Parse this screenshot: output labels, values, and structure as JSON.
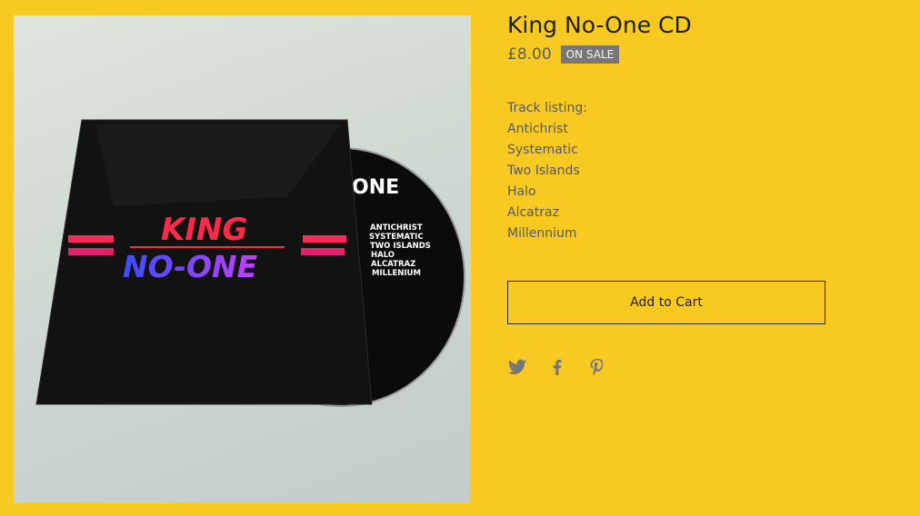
{
  "product": {
    "title": "King No-One CD",
    "price": "£8.00",
    "badge": "ON SALE",
    "image_alt": "King No-One CD in black sleeve with disc partly out",
    "cover_logo": [
      "KING",
      "NO-ONE"
    ],
    "disc_logo": "ONE",
    "disc_tracks": [
      "ANTICHRIST",
      "SYSTEMATIC",
      "TWO ISLANDS",
      "HALO",
      "ALCATRAZ",
      "MILLENIUM"
    ],
    "description": {
      "heading": "Track listing:",
      "tracks": [
        "Antichrist",
        "Systematic",
        "Two Islands",
        "Halo",
        "Alcatraz",
        "Millennium"
      ]
    },
    "add_to_cart": "Add to Cart"
  },
  "share": {
    "icons": [
      "twitter-icon",
      "facebook-icon",
      "pinterest-icon"
    ]
  },
  "colors": {
    "background": "#f7c921",
    "text": "#1f1f1f",
    "muted": "#777777",
    "badge": "#777777"
  }
}
